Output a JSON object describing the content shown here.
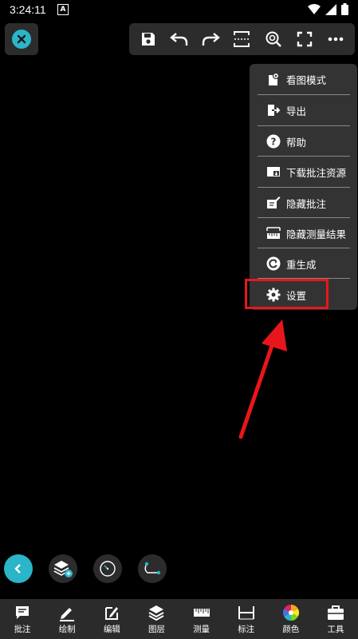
{
  "status_bar": {
    "time": "3:24:11",
    "notification_letter": "A"
  },
  "menu": {
    "items": [
      {
        "label": "看图模式",
        "icon": "view-mode-icon"
      },
      {
        "label": "导出",
        "icon": "export-icon"
      },
      {
        "label": "帮助",
        "icon": "help-icon"
      },
      {
        "label": "下载批注资源",
        "icon": "download-annotation-icon"
      },
      {
        "label": "隐藏批注",
        "icon": "hide-annotation-icon"
      },
      {
        "label": "隐藏测量结果",
        "icon": "hide-measure-icon"
      },
      {
        "label": "重生成",
        "icon": "regenerate-icon"
      },
      {
        "label": "设置",
        "icon": "gear-icon"
      }
    ]
  },
  "bottom_nav": {
    "items": [
      {
        "label": "批注",
        "icon": "annotation-icon"
      },
      {
        "label": "绘制",
        "icon": "pencil-icon"
      },
      {
        "label": "编辑",
        "icon": "edit-icon"
      },
      {
        "label": "图层",
        "icon": "layers-icon"
      },
      {
        "label": "测量",
        "icon": "ruler-icon"
      },
      {
        "label": "标注",
        "icon": "dimension-icon"
      },
      {
        "label": "颜色",
        "icon": "color-wheel-icon"
      },
      {
        "label": "工具",
        "icon": "toolbox-icon"
      }
    ]
  },
  "colors": {
    "accent": "#2ab5c8",
    "highlight": "#e8161b",
    "panel": "#2c2c2c",
    "menu": "#333333"
  }
}
